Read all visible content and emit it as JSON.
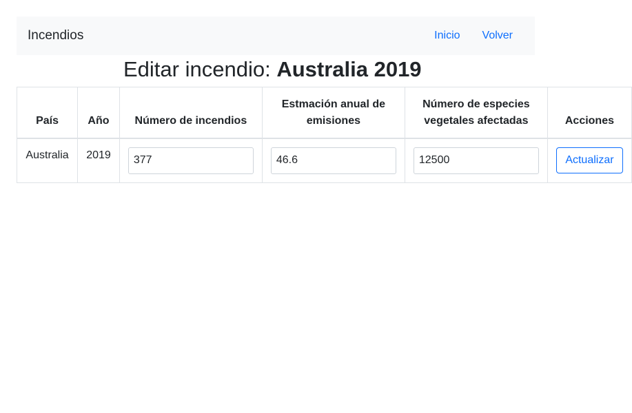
{
  "navbar": {
    "brand": "Incendios",
    "links": [
      {
        "label": "Inicio"
      },
      {
        "label": "Volver"
      }
    ]
  },
  "heading": {
    "prefix": "Editar incendio: ",
    "subject": "Australia 2019"
  },
  "table": {
    "headers": {
      "country": "País",
      "year": "Año",
      "fires": "Número de incendios",
      "emissions": "Estmación anual de emisiones",
      "species": "Número de especies vegetales afectadas",
      "actions": "Acciones"
    },
    "row": {
      "country": "Australia",
      "year": "2019",
      "fires": "377",
      "emissions": "46.6",
      "species": "12500",
      "update_label": "Actualizar"
    }
  }
}
